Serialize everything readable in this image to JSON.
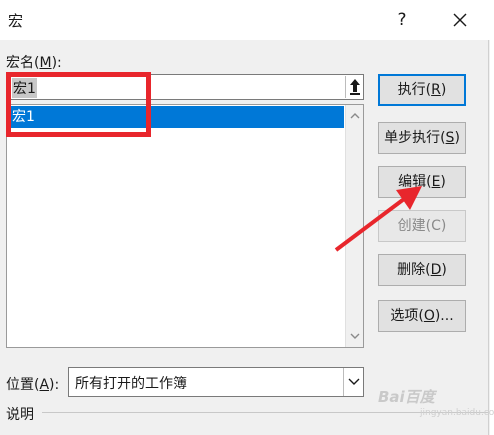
{
  "dialog": {
    "title": "宏",
    "help_label": "?",
    "macro_name_label_prefix": "宏名(",
    "macro_name_label_key": "M",
    "macro_name_label_suffix": "):",
    "macro_name_value": "宏1",
    "macro_list": [
      "宏1"
    ],
    "location_label_prefix": "位置(",
    "location_label_key": "A",
    "location_label_suffix": "):",
    "location_value": "所有打开的工作簿",
    "description_label": "说明"
  },
  "buttons": {
    "run": {
      "text": "执行(",
      "key": "R",
      "end": ")"
    },
    "step_into": {
      "text": "单步执行(",
      "key": "S",
      "end": ")"
    },
    "edit": {
      "text": "编辑(",
      "key": "E",
      "end": ")"
    },
    "create": {
      "text": "创建(",
      "key": "C",
      "end": ")"
    },
    "delete": {
      "text": "删除(",
      "key": "D",
      "end": ")"
    },
    "options": {
      "text": "选项(",
      "key": "O",
      "end": ")..."
    }
  },
  "watermark": {
    "brand": "Bai百度",
    "sub": "jingyan.baidu.com"
  },
  "colors": {
    "selection": "#0078d7",
    "annotation": "#e8262c",
    "default_border": "#0078d7"
  },
  "icons": {
    "close": "close-icon",
    "arrow_up": "arrow-up-icon",
    "dropdown": "chevron-down-icon"
  }
}
